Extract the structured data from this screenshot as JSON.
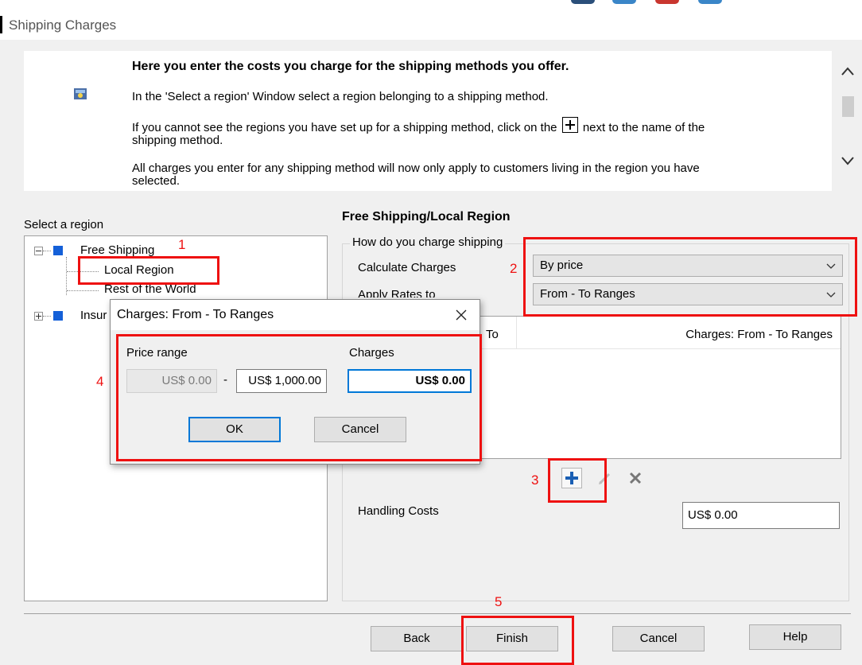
{
  "window": {
    "title": "Shipping Charges"
  },
  "info": {
    "heading": "Here you enter the costs you charge for the shipping methods you offer.",
    "line1": "In the 'Select a region' Window select a region belonging to a shipping method.",
    "line2a": "If you cannot see the regions you have set up for a shipping method, click on the",
    "line2b": "next to the name of the",
    "line2c": "shipping method.",
    "line3a": "All charges you enter for any shipping method will now only apply to customers living in the region you have",
    "line3b": "selected."
  },
  "region_panel": {
    "label": "Select a region",
    "tree": [
      {
        "label": "Free Shipping",
        "children": [
          "Local Region",
          "Rest of the World"
        ]
      },
      {
        "label": "Insur"
      }
    ]
  },
  "details": {
    "title": "Free Shipping/Local Region",
    "group_legend": "How do you charge shipping",
    "calc_label": "Calculate Charges",
    "calc_value": "By price",
    "apply_label": "Apply Rates to",
    "apply_value": "From - To Ranges",
    "grid_col_to": "To",
    "grid_col_charges": "Charges:  From - To Ranges",
    "handling_label": "Handling Costs",
    "handling_value": "US$ 0.00"
  },
  "buttons": {
    "back": "Back",
    "finish": "Finish",
    "cancel": "Cancel",
    "help": "Help"
  },
  "dialog": {
    "title": "Charges:  From - To Ranges",
    "price_range_label": "Price range",
    "from_value": "US$ 0.00",
    "dash": "-",
    "to_value": "US$ 1,000.00",
    "charges_label": "Charges",
    "charges_value": "US$ 0.00",
    "ok": "OK",
    "cancel": "Cancel"
  },
  "annotations": [
    "1",
    "2",
    "3",
    "4",
    "5"
  ],
  "colors": {
    "annotation_red": "#ee1111",
    "tree_blue": "#1460d8",
    "focus_blue": "#0078d7"
  },
  "icons": {
    "add": "plus-icon",
    "edit": "pencil-icon",
    "delete": "x-icon",
    "close": "close-icon",
    "dropdown": "chevron-down-icon"
  }
}
